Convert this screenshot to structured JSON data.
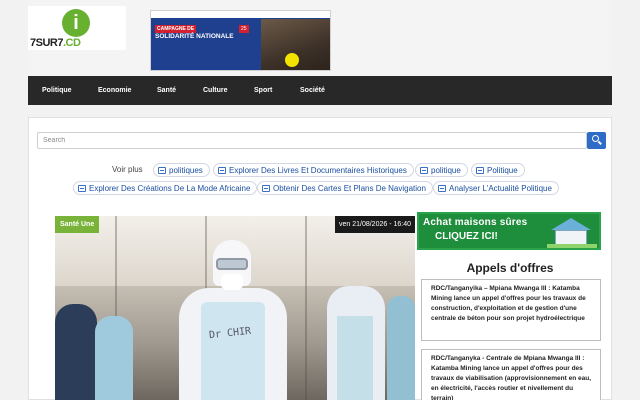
{
  "header": {
    "logo": {
      "mark": "i",
      "text_main": "7SUR7",
      "text_suffix": ".CD"
    },
    "banner": {
      "tag": "CAMPAGNE DE",
      "title": "SOLIDARITÉ NATIONALE",
      "date": "25"
    }
  },
  "nav": {
    "items": [
      "Politique",
      "Economie",
      "Santé",
      "Culture",
      "Sport",
      "Société"
    ]
  },
  "search": {
    "placeholder": "Search",
    "icon": "search-icon"
  },
  "related": {
    "label": "Voir plus",
    "links": [
      "politiques",
      "Explorer Des Livres Et Documentaires Historiques",
      "politique",
      "Politique",
      "Explorer Des Créations De La Mode Africaine",
      "Obtenir Des Cartes Et Plans De Navigation",
      "Analyser L'Actualité Politique"
    ]
  },
  "featured": {
    "category": "Santé Une",
    "date": "ven 21/08/2026 - 16:40",
    "photo_writing": "Dr CHIR"
  },
  "ad": {
    "line1": "Achat maisons sûres",
    "line2": "CLIQUEZ ICI!"
  },
  "sidebar": {
    "title": "Appels d'offres",
    "offers": [
      "RDC/Tanganyika – Mpiana Mwanga III : Katamba Mining lance un appel d'offres pour les travaux de construction, d'exploitation et de gestion d'une centrale de béton pour son projet hydroélectrique",
      "RDC/Tanganyka - Centrale de Mpiana Mwanga III : Katamba Mining lance un appel d'offres pour des travaux de viabilisation (approvisionnement en eau, en électricité, l'accès routier et nivellement du terrain)"
    ]
  },
  "colors": {
    "nav_bg": "#282828",
    "accent_green": "#7ab33a",
    "search_button": "#2f6cc5",
    "link_blue": "#1b4fa0"
  }
}
